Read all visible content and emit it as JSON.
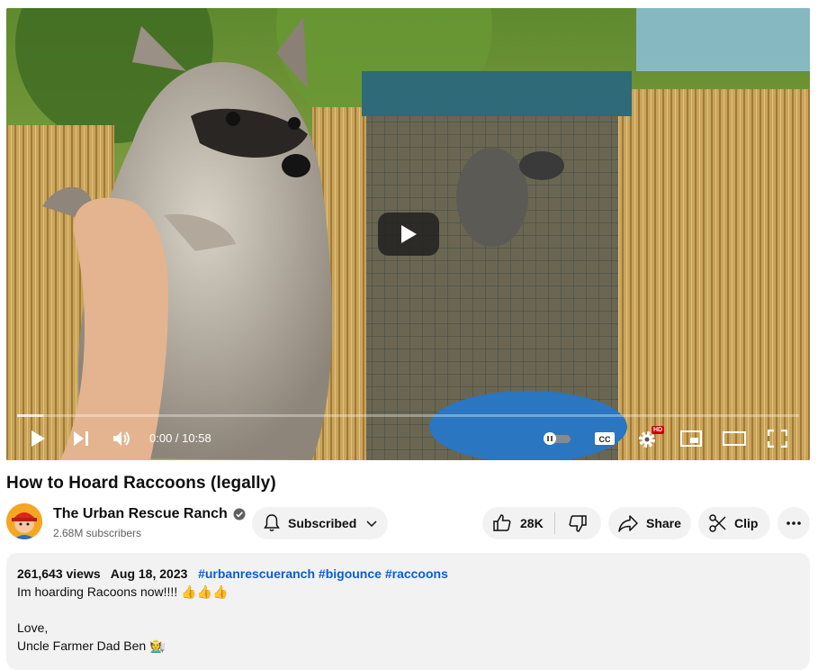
{
  "player": {
    "time_current": "0:00",
    "time_total": "10:58",
    "progress_buffered": 0.033,
    "hd_badge": "HD"
  },
  "video": {
    "title": "How to Hoard Raccoons (legally)"
  },
  "channel": {
    "name": "The Urban Rescue Ranch",
    "subscribers": "2.68M subscribers",
    "subscribe_label": "Subscribed"
  },
  "actions": {
    "likes": "28K",
    "share_label": "Share",
    "clip_label": "Clip"
  },
  "description": {
    "views": "261,643 views",
    "date": "Aug 18, 2023",
    "hashtags": [
      "#urbanrescueranch",
      "#bigounce",
      "#raccoons"
    ],
    "line1": "Im hoarding Racoons now!!!! 👍👍👍",
    "line2": "Love,",
    "line3": "Uncle Farmer Dad Ben 🧑‍🌾"
  },
  "colors": {
    "link": "#065fd4",
    "pill_bg": "#f2f2f2",
    "hd_badge": "#cc0000"
  }
}
